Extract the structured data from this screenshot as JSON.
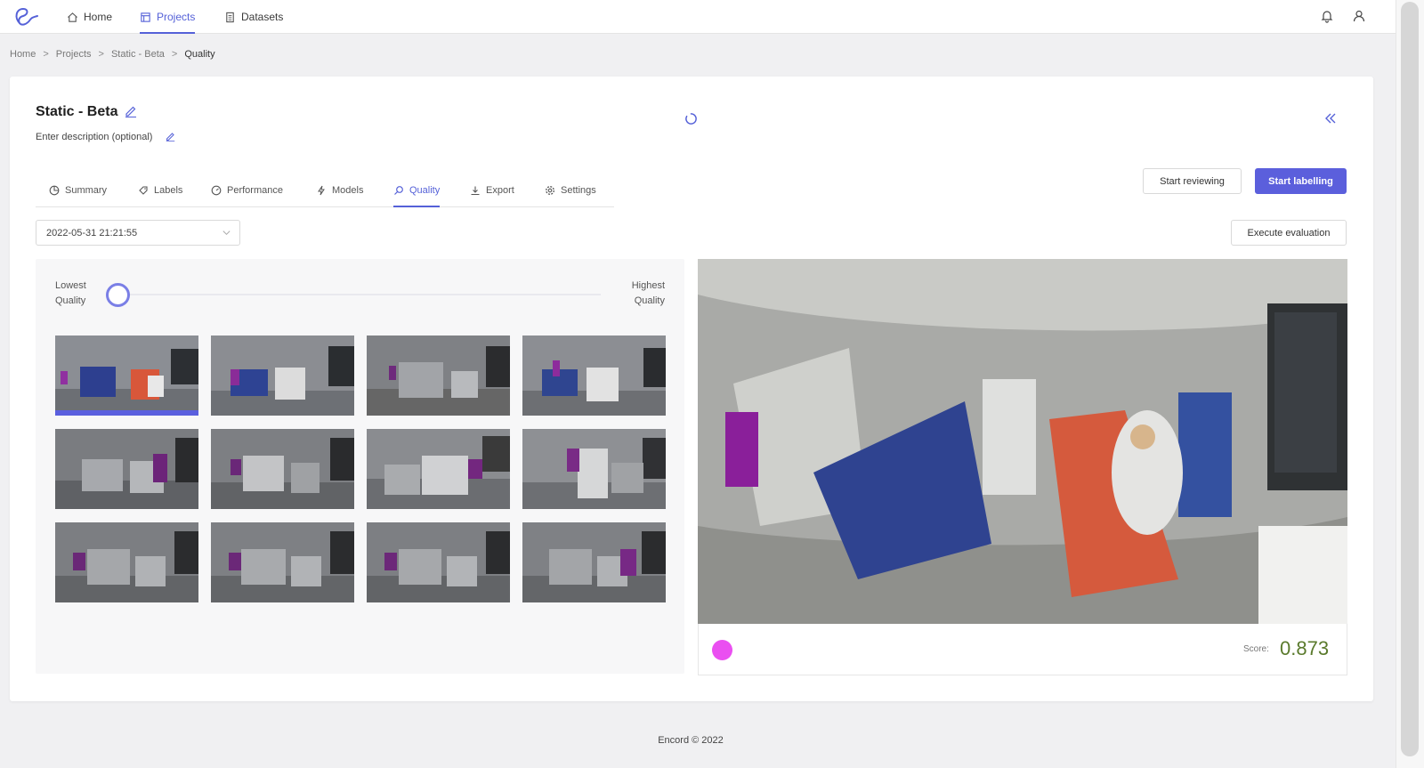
{
  "nav": {
    "items": [
      {
        "label": "Home",
        "icon": "home-icon"
      },
      {
        "label": "Projects",
        "icon": "projects-icon",
        "active": true
      },
      {
        "label": "Datasets",
        "icon": "datasets-icon"
      }
    ],
    "right_icons": [
      "bell-icon",
      "user-icon"
    ]
  },
  "breadcrumb": [
    "Home",
    "Projects",
    "Static - Beta",
    "Quality"
  ],
  "project": {
    "title": "Static - Beta",
    "description_placeholder": "Enter description (optional)"
  },
  "tabs": [
    {
      "label": "Summary",
      "icon": "pie-chart-icon"
    },
    {
      "label": "Labels",
      "icon": "tag-icon"
    },
    {
      "label": "Performance",
      "icon": "dashboard-icon"
    },
    {
      "label": "Models",
      "icon": "lightning-icon"
    },
    {
      "label": "Quality",
      "icon": "quality-search-icon",
      "active": true
    },
    {
      "label": "Export",
      "icon": "download-icon"
    },
    {
      "label": "Settings",
      "icon": "gear-icon"
    }
  ],
  "actions": {
    "start_reviewing": "Start reviewing",
    "start_labelling": "Start labelling",
    "execute_evaluation": "Execute evaluation"
  },
  "evaluation_select": {
    "selected": "2022-05-31 21:21:55"
  },
  "quality_slider": {
    "low_label_1": "Lowest",
    "low_label_2": "Quality",
    "high_label_1": "Highest",
    "high_label_2": "Quality",
    "value": 0
  },
  "thumbnails": {
    "count": 12,
    "selected_index": 0
  },
  "preview": {
    "label_color": "#ea4ff1",
    "score_label": "Score:",
    "score": "0.873"
  },
  "footer": "Encord © 2022",
  "colors": {
    "accent": "#5561d8",
    "primary_button": "#5b5fdc",
    "score": "#5a7a2c",
    "annotation": "#8a1f9a"
  }
}
